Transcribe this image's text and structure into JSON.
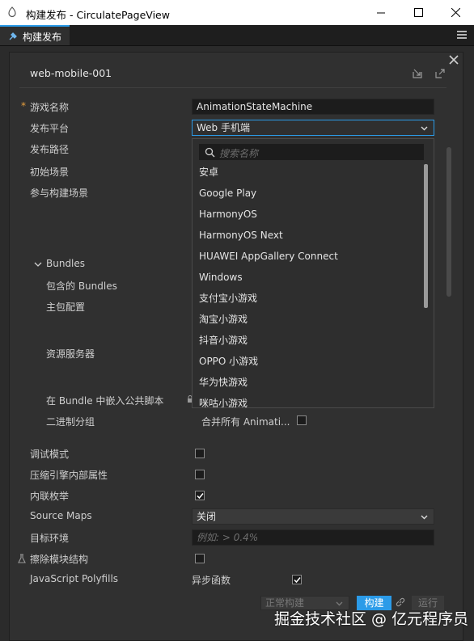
{
  "window": {
    "title": "构建发布 - CirculatePageView",
    "controls": [
      "minimize-icon",
      "maximize-icon",
      "close-icon"
    ]
  },
  "tab": {
    "label": "构建发布",
    "menu_icon": "hamburger-icon"
  },
  "panel": {
    "task_name": "web-mobile-001",
    "header_icons": [
      "export-icon",
      "open-external-icon"
    ],
    "close_icon": "close-icon"
  },
  "form": {
    "game_name": {
      "label": "游戏名称",
      "value": "AnimationStateMachine",
      "required_mark": "*"
    },
    "platform": {
      "label": "发布平台",
      "value": "Web 手机端"
    },
    "build_path": {
      "label": "发布路径"
    },
    "start_scene": {
      "label": "初始场景"
    },
    "build_scenes": {
      "label": "参与构建场景"
    },
    "bundles": {
      "label": "Bundles",
      "included": "包含的 Bundles",
      "main_config": "主包配置",
      "asset_server": "资源服务器",
      "embed_script": "在 Bundle 中嵌入公共脚本",
      "binary_group": "二进制分组",
      "merge_all": "合并所有 Animati..."
    },
    "debug_mode": {
      "label": "调试模式",
      "checked": false
    },
    "compress_engine": {
      "label": "压缩引擎内部属性",
      "checked": false
    },
    "inline_enum": {
      "label": "内联枚举",
      "checked": true
    },
    "source_maps": {
      "label": "Source Maps",
      "value": "关闭"
    },
    "target_env": {
      "label": "目标环境",
      "placeholder": "例如: > 0.4%"
    },
    "remove_module": {
      "label": "擦除模块结构",
      "checked": false
    },
    "polyfills": {
      "label": "JavaScript Polyfills",
      "async_label": "异步函数",
      "async_checked": true
    }
  },
  "dropdown": {
    "search_placeholder": "搜索名称",
    "items": [
      "安卓",
      "Google Play",
      "HarmonyOS",
      "HarmonyOS Next",
      "HUAWEI AppGallery Connect",
      "Windows",
      "支付宝小游戏",
      "淘宝小游戏",
      "抖音小游戏",
      "OPPO 小游戏",
      "华为快游戏",
      "咪咕小游戏"
    ]
  },
  "footer": {
    "build_mode": "正常构建",
    "build_label": "构建",
    "run_label": "运行"
  },
  "watermark": "掘金技术社区 @ 亿元程序员",
  "colors": {
    "accent": "#2b9be8",
    "required": "#e8a03e",
    "panel_bg": "#303030"
  }
}
